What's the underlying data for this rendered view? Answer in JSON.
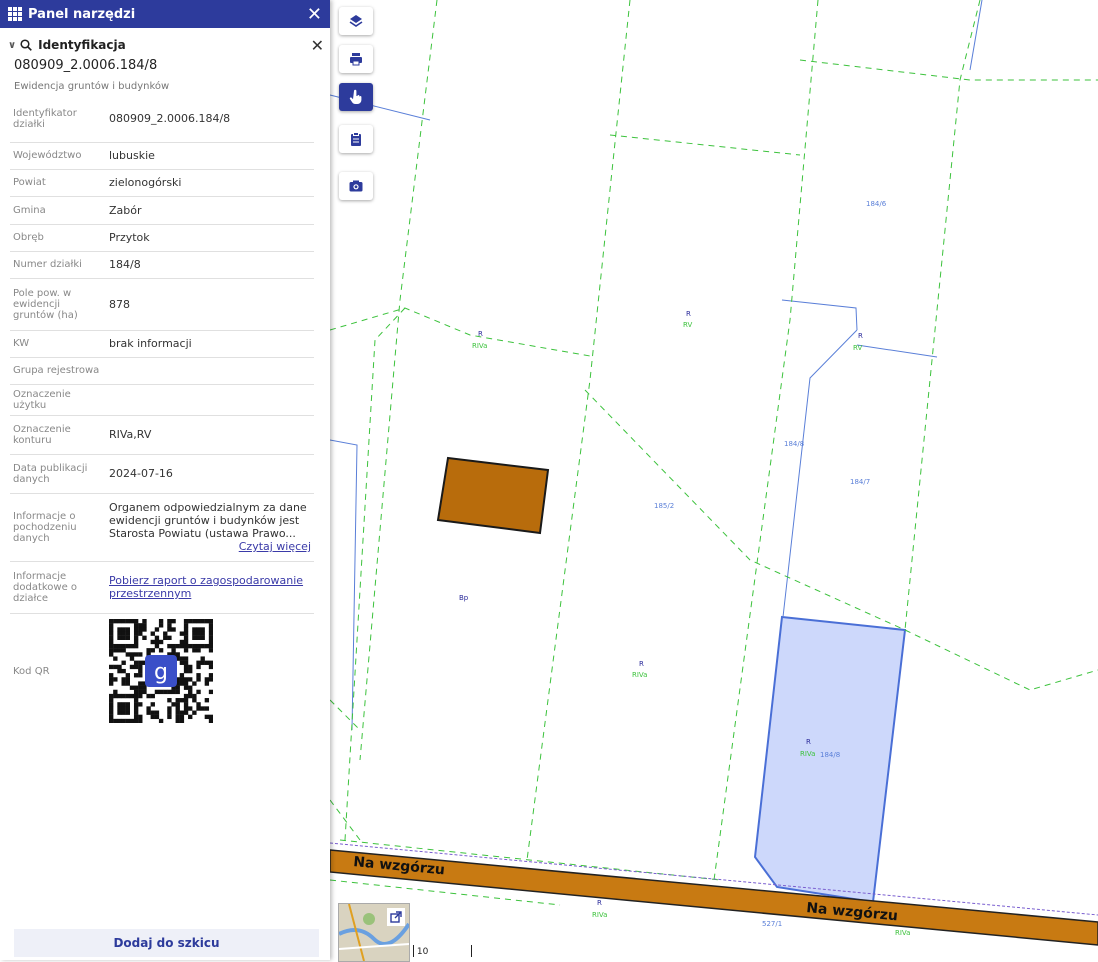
{
  "panel": {
    "title": "Panel narzędzi",
    "close": "✕"
  },
  "section": {
    "title": "Identyfikacja",
    "close": "✕"
  },
  "parcel": {
    "id": "080909_2.0006.184/8",
    "subtitle": "Ewidencja gruntów i budynków",
    "rows": [
      {
        "key": "Identyfikator działki",
        "value": "080909_2.0006.184/8"
      },
      {
        "key": "Województwo",
        "value": "lubuskie"
      },
      {
        "key": "Powiat",
        "value": "zielonogórski"
      },
      {
        "key": "Gmina",
        "value": "Zabór"
      },
      {
        "key": "Obręb",
        "value": "Przytok"
      },
      {
        "key": "Numer działki",
        "value": "184/8"
      },
      {
        "key": "Pole pow. w ewidencji gruntów (ha)",
        "value": "878"
      },
      {
        "key": "KW",
        "value": "brak informacji"
      },
      {
        "key": "Grupa rejestrowa",
        "value": ""
      },
      {
        "key": "Oznaczenie użytku",
        "value": ""
      },
      {
        "key": "Oznaczenie konturu",
        "value": "RIVa,RV"
      },
      {
        "key": "Data publikacji danych",
        "value": "2024-07-16"
      }
    ],
    "origin_key": "Informacje o pochodzeniu danych",
    "origin_value": "Organem odpowiedzialnym za dane ewidencji gruntów i budynków jest Starosta Powiatu (ustawa Prawo...",
    "origin_more": "Czytaj więcej",
    "extra_key": "Informacje dodatkowe o działce",
    "extra_link": "Pobierz raport o zagospodarowanie przestrzennym",
    "qr_key": "Kod QR"
  },
  "bottom_button": "Dodaj do szkicu",
  "toolbar": [
    {
      "name": "layers-icon"
    },
    {
      "name": "print-icon"
    },
    {
      "name": "identify-hand-icon"
    },
    {
      "name": "clipboard-icon"
    },
    {
      "name": "camera-icon"
    }
  ],
  "map": {
    "road_name": "Na wzgórzu",
    "labels": {
      "l1": "R",
      "l2": "RIVa",
      "l3": "R",
      "l4": "RV",
      "l5": "184/6",
      "l6": "R",
      "l7": "RV",
      "l8": "184/8",
      "l9": "184/7",
      "l10": "185/2",
      "l11": "Bp",
      "l12": "R",
      "l13": "RIVa",
      "l14": "R",
      "l15": "RIVa",
      "l16": "184/8",
      "l17": "R",
      "l18": "RIVa",
      "l19": "527/1",
      "l20": "RIVa"
    },
    "scale": "10"
  },
  "colors": {
    "accent": "#2d3b9c",
    "parcel_boundary": "#4a6fd6",
    "contour": "#3cc23c",
    "road": "#c87a12",
    "building": "#b86c0c",
    "selected_fill": "#cdd8fb"
  }
}
